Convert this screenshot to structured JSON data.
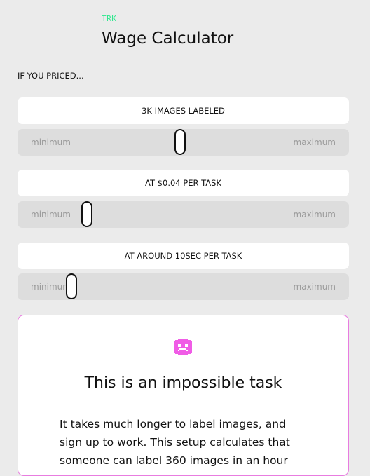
{
  "header": {
    "logo": "TRK",
    "title": "Wage Calculator"
  },
  "intro": "IF YOU PRICED...",
  "controls": [
    {
      "label": "3K IMAGES LABELED",
      "min_label": "minimum",
      "max_label": "maximum",
      "value_fraction": 0.49
    },
    {
      "label": "AT $0.04 PER TASK",
      "min_label": "minimum",
      "max_label": "maximum",
      "value_fraction": 0.2
    },
    {
      "label": "AT AROUND 10SEC PER TASK",
      "min_label": "minimum",
      "max_label": "maximum",
      "value_fraction": 0.15
    }
  ],
  "result": {
    "icon": "sad-face-icon",
    "title": "This is an impossible task",
    "body_lines": [
      "It takes much longer to label images, and",
      "sign up to work. This setup calculates that",
      "someone can label 360 images in an hour"
    ]
  },
  "colors": {
    "background": "#ebebeb",
    "logo": "#2ee88e",
    "result_border": "#e87ce0",
    "sad_icon": "#f05ce6"
  }
}
